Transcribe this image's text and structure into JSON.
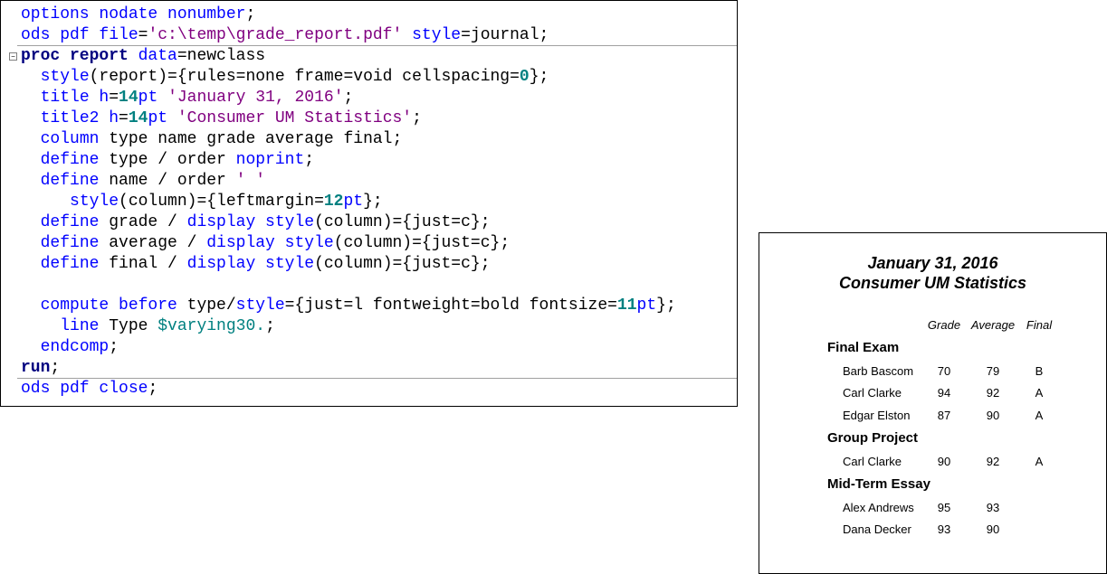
{
  "editor": {
    "lines": [
      [
        [
          "kw",
          "options nodate nonumber"
        ],
        [
          "tx",
          ";"
        ]
      ],
      [
        [
          "kw",
          "ods pdf file"
        ],
        [
          "tx",
          "="
        ],
        [
          "str",
          "'c:\\temp\\grade_report.pdf'"
        ],
        [
          "kw",
          " style"
        ],
        [
          "tx",
          "=journal;"
        ]
      ],
      [
        [
          "proc",
          "proc report"
        ],
        [
          "kw",
          " data"
        ],
        [
          "tx",
          "=newclass"
        ]
      ],
      [
        [
          "tx",
          "  "
        ],
        [
          "kw",
          "style"
        ],
        [
          "tx",
          "(report)={rules=none frame=void cellspacing="
        ],
        [
          "num",
          "0"
        ],
        [
          "tx",
          "};"
        ]
      ],
      [
        [
          "tx",
          "  "
        ],
        [
          "kw",
          "title h"
        ],
        [
          "tx",
          "="
        ],
        [
          "num",
          "14"
        ],
        [
          "kw",
          "pt "
        ],
        [
          "str",
          "'January 31, 2016'"
        ],
        [
          "tx",
          ";"
        ]
      ],
      [
        [
          "tx",
          "  "
        ],
        [
          "kw",
          "title2 h"
        ],
        [
          "tx",
          "="
        ],
        [
          "num",
          "14"
        ],
        [
          "kw",
          "pt "
        ],
        [
          "str",
          "'Consumer UM Statistics'"
        ],
        [
          "tx",
          ";"
        ]
      ],
      [
        [
          "tx",
          "  "
        ],
        [
          "kw",
          "column"
        ],
        [
          "tx",
          " type name grade average final;"
        ]
      ],
      [
        [
          "tx",
          "  "
        ],
        [
          "kw",
          "define"
        ],
        [
          "tx",
          " type / order "
        ],
        [
          "kw",
          "noprint"
        ],
        [
          "tx",
          ";"
        ]
      ],
      [
        [
          "tx",
          "  "
        ],
        [
          "kw",
          "define"
        ],
        [
          "tx",
          " name / order "
        ],
        [
          "str",
          "' '"
        ]
      ],
      [
        [
          "tx",
          "     "
        ],
        [
          "kw",
          "style"
        ],
        [
          "tx",
          "(column)={leftmargin="
        ],
        [
          "num",
          "12"
        ],
        [
          "kw",
          "pt"
        ],
        [
          "tx",
          "};"
        ]
      ],
      [
        [
          "tx",
          "  "
        ],
        [
          "kw",
          "define"
        ],
        [
          "tx",
          " grade / "
        ],
        [
          "kw",
          "display style"
        ],
        [
          "tx",
          "(column)={just=c};"
        ]
      ],
      [
        [
          "tx",
          "  "
        ],
        [
          "kw",
          "define"
        ],
        [
          "tx",
          " average / "
        ],
        [
          "kw",
          "display style"
        ],
        [
          "tx",
          "(column)={just=c};"
        ]
      ],
      [
        [
          "tx",
          "  "
        ],
        [
          "kw",
          "define"
        ],
        [
          "tx",
          " final / "
        ],
        [
          "kw",
          "display style"
        ],
        [
          "tx",
          "(column)={just=c};"
        ]
      ],
      [],
      [
        [
          "tx",
          "  "
        ],
        [
          "kw",
          "compute before"
        ],
        [
          "tx",
          " type/"
        ],
        [
          "kw",
          "style"
        ],
        [
          "tx",
          "={just=l fontweight=bold fontsize="
        ],
        [
          "num",
          "11"
        ],
        [
          "kw",
          "pt"
        ],
        [
          "tx",
          "};"
        ]
      ],
      [
        [
          "tx",
          "    "
        ],
        [
          "kw",
          "line"
        ],
        [
          "tx",
          " Type "
        ],
        [
          "fmt",
          "$varying30."
        ],
        [
          "tx",
          ";"
        ]
      ],
      [
        [
          "tx",
          "  "
        ],
        [
          "kw",
          "endcomp"
        ],
        [
          "tx",
          ";"
        ]
      ],
      [
        [
          "proc",
          "run"
        ],
        [
          "tx",
          ";"
        ]
      ],
      [
        [
          "kw",
          "ods pdf close"
        ],
        [
          "tx",
          ";"
        ]
      ]
    ]
  },
  "report": {
    "title1": "January 31, 2016",
    "title2": "Consumer UM Statistics",
    "headers": {
      "grade": "Grade",
      "average": "Average",
      "final": "Final"
    },
    "groups": [
      {
        "label": "Final  Exam",
        "rows": [
          [
            "Barb Bascom",
            "70",
            "79",
            "B"
          ],
          [
            "Carl Clarke",
            "94",
            "92",
            "A"
          ],
          [
            "Edgar Elston",
            "87",
            "90",
            "A"
          ]
        ]
      },
      {
        "label": "Group  Project",
        "rows": [
          [
            "Carl Clarke",
            "90",
            "92",
            "A"
          ]
        ]
      },
      {
        "label": "Mid-Term  Essay",
        "rows": [
          [
            "Alex Andrews",
            "95",
            "93",
            ""
          ],
          [
            "Dana Decker",
            "93",
            "90",
            ""
          ]
        ]
      }
    ]
  }
}
